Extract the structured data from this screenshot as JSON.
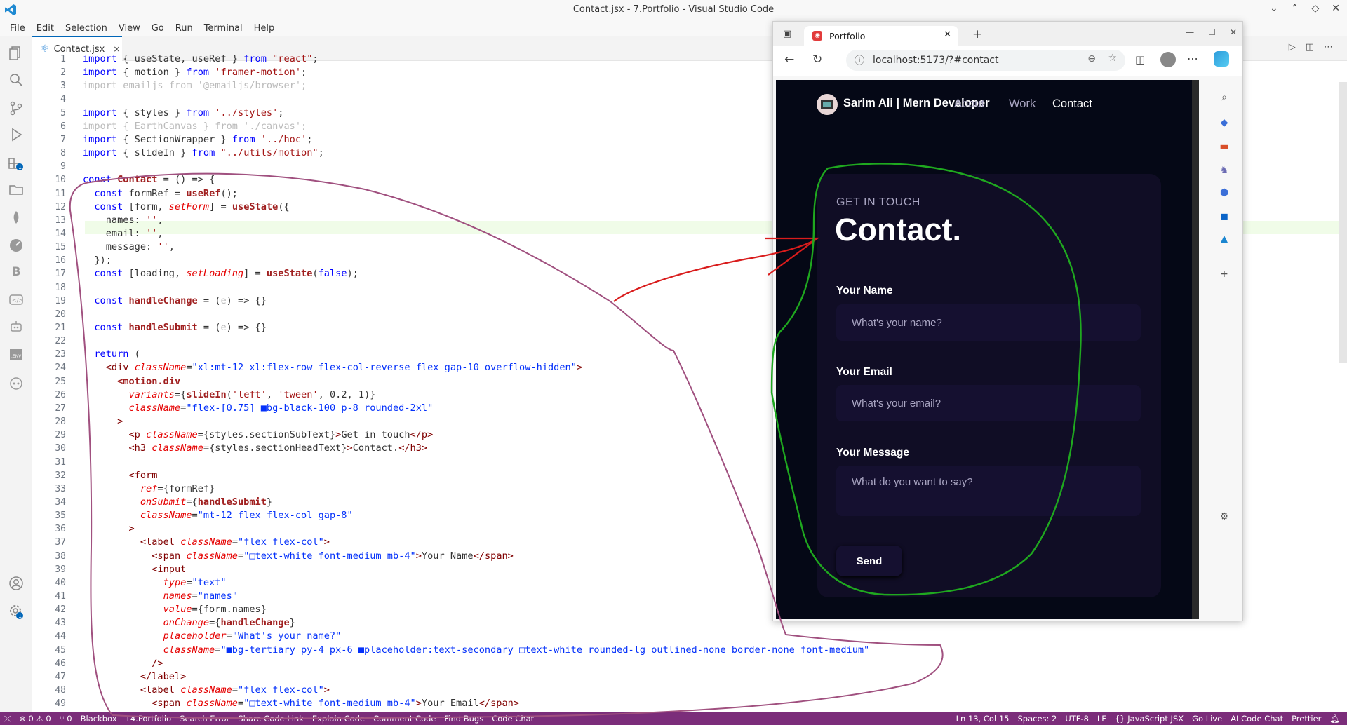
{
  "window": {
    "title": "Contact.jsx - 7.Portfolio - Visual Studio Code"
  },
  "menu": [
    "File",
    "Edit",
    "Selection",
    "View",
    "Go",
    "Run",
    "Terminal",
    "Help"
  ],
  "tab": {
    "label": "Contact.jsx",
    "close": "×"
  },
  "editor": {
    "lines": [
      {
        "n": "1",
        "html": "<span class='kw'>import</span> { useState, useRef } <span class='kw'>from</span> <span class='str'>\"react\"</span>;"
      },
      {
        "n": "2",
        "html": "<span class='kw'>import</span> { motion } <span class='kw'>from</span> <span class='str'>'framer-motion'</span>;"
      },
      {
        "n": "3",
        "html": "<span class='cm'>import emailjs from '@emailjs/browser';</span>"
      },
      {
        "n": "4",
        "html": ""
      },
      {
        "n": "5",
        "html": "<span class='kw'>import</span> { styles } <span class='kw'>from</span> <span class='str'>'../styles'</span>;"
      },
      {
        "n": "6",
        "html": "<span class='cm'>import { EarthCanvas } from './canvas';</span>"
      },
      {
        "n": "7",
        "html": "<span class='kw'>import</span> { SectionWrapper } <span class='kw'>from</span> <span class='str'>'../hoc'</span>;"
      },
      {
        "n": "8",
        "html": "<span class='kw'>import</span> { slideIn } <span class='kw'>from</span> <span class='str'>\"../utils/motion\"</span>;"
      },
      {
        "n": "9",
        "html": ""
      },
      {
        "n": "10",
        "html": "<span class='kw'>const</span> <span class='fn'>Contact</span> = () => {"
      },
      {
        "n": "11",
        "html": "  <span class='kw'>const</span> formRef = <span class='fn'>useRef</span>();"
      },
      {
        "n": "12",
        "html": "  <span class='kw'>const</span> [form, <span class='at'>setForm</span>] = <span class='fn'>useState</span>({"
      },
      {
        "n": "13",
        "html": "    names: <span class='str'>''</span>,"
      },
      {
        "n": "14",
        "html": "    email: <span class='str'>''</span>,"
      },
      {
        "n": "15",
        "html": "    message: <span class='str'>''</span>,"
      },
      {
        "n": "16",
        "html": "  });"
      },
      {
        "n": "17",
        "html": "  <span class='kw'>const</span> [loading, <span class='at'>setLoading</span>] = <span class='fn'>useState</span>(<span class='kw'>false</span>);"
      },
      {
        "n": "18",
        "html": ""
      },
      {
        "n": "19",
        "html": "  <span class='kw'>const</span> <span class='fn'>handleChange</span> = (<span class='cm'>e</span>) => {}"
      },
      {
        "n": "20",
        "html": ""
      },
      {
        "n": "21",
        "html": "  <span class='kw'>const</span> <span class='fn'>handleSubmit</span> = (<span class='cm'>e</span>) => {}"
      },
      {
        "n": "22",
        "html": ""
      },
      {
        "n": "23",
        "html": "  <span class='kw'>return</span> ("
      },
      {
        "n": "24",
        "html": "    <span class='tg'>&lt;div</span> <span class='at'>className</span>=<span class='br'>\"xl:mt-12 xl:flex-row flex-col-reverse flex gap-10 overflow-hidden\"</span><span class='tg'>&gt;</span>"
      },
      {
        "n": "25",
        "html": "      <span class='fn'>&lt;motion.div</span>"
      },
      {
        "n": "26",
        "html": "        <span class='at'>variants</span>={<span class='fn'>slideIn</span>(<span class='str'>'left'</span>, <span class='str'>'tween'</span>, 0.2, 1)}"
      },
      {
        "n": "27",
        "html": "        <span class='at'>className</span>=<span class='br'>\"flex-[0.75] ■bg-black-100 p-8 rounded-2xl\"</span>"
      },
      {
        "n": "28",
        "html": "      <span class='tg'>&gt;</span>"
      },
      {
        "n": "29",
        "html": "        <span class='tg'>&lt;p</span> <span class='at'>className</span>={styles.sectionSubText}<span class='tg'>&gt;</span>Get in touch<span class='tg'>&lt;/p&gt;</span>"
      },
      {
        "n": "30",
        "html": "        <span class='tg'>&lt;h3</span> <span class='at'>className</span>={styles.sectionHeadText}<span class='tg'>&gt;</span>Contact.<span class='tg'>&lt;/h3&gt;</span>"
      },
      {
        "n": "31",
        "html": ""
      },
      {
        "n": "32",
        "html": "        <span class='tg'>&lt;form</span>"
      },
      {
        "n": "33",
        "html": "          <span class='at'>ref</span>={formRef}"
      },
      {
        "n": "34",
        "html": "          <span class='at'>onSubmit</span>={<span class='fn'>handleSubmit</span>}"
      },
      {
        "n": "35",
        "html": "          <span class='at'>className</span>=<span class='br'>\"mt-12 flex flex-col gap-8\"</span>"
      },
      {
        "n": "36",
        "html": "        <span class='tg'>&gt;</span>"
      },
      {
        "n": "37",
        "html": "          <span class='tg'>&lt;label</span> <span class='at'>className</span>=<span class='br'>\"flex flex-col\"</span><span class='tg'>&gt;</span>"
      },
      {
        "n": "38",
        "html": "            <span class='tg'>&lt;span</span> <span class='at'>className</span>=<span class='br'>\"□text-white font-medium mb-4\"</span><span class='tg'>&gt;</span>Your Name<span class='tg'>&lt;/span&gt;</span>"
      },
      {
        "n": "39",
        "html": "            <span class='tg'>&lt;input</span>"
      },
      {
        "n": "40",
        "html": "              <span class='at'>type</span>=<span class='br'>\"text\"</span>"
      },
      {
        "n": "41",
        "html": "              <span class='at'>names</span>=<span class='br'>\"names\"</span>"
      },
      {
        "n": "42",
        "html": "              <span class='at'>value</span>={form.names}"
      },
      {
        "n": "43",
        "html": "              <span class='at'>onChange</span>={<span class='fn'>handleChange</span>}"
      },
      {
        "n": "44",
        "html": "              <span class='at'>placeholder</span>=<span class='br'>\"What's your name?\"</span>"
      },
      {
        "n": "45",
        "html": "              <span class='at'>className</span>=<span class='br'>\"■bg-tertiary py-4 px-6 ■placeholder:text-secondary □text-white rounded-lg outlined-none border-none font-medium\"</span>"
      },
      {
        "n": "46",
        "html": "            <span class='tg'>/&gt;</span>"
      },
      {
        "n": "47",
        "html": "          <span class='tg'>&lt;/label&gt;</span>"
      },
      {
        "n": "48",
        "html": "          <span class='tg'>&lt;label</span> <span class='at'>className</span>=<span class='br'>\"flex flex-col\"</span><span class='tg'>&gt;</span>"
      },
      {
        "n": "49",
        "html": "            <span class='tg'>&lt;span</span> <span class='at'>className</span>=<span class='br'>\"□text-white font-medium mb-4\"</span><span class='tg'>&gt;</span>Your Email<span class='tg'>&lt;/span&gt;</span>"
      }
    ]
  },
  "statusbar": {
    "left": [
      "⊗ 0 ⚠ 0",
      "⑂ 0",
      "Blackbox",
      "14.Portfolio",
      "Search Error",
      "Share Code Link",
      "Explain Code",
      "Comment Code",
      "Find Bugs",
      "Code Chat"
    ],
    "right": [
      "Ln 13, Col 15",
      "Spaces: 2",
      "UTF-8",
      "LF",
      "{} JavaScript JSX",
      "Go Live",
      "AI Code Chat",
      "Prettier"
    ]
  },
  "browser": {
    "tab_title": "Portfolio",
    "url": "localhost:5173/?#contact"
  },
  "site": {
    "brand": "Sarim Ali  | Mern Developer",
    "nav": [
      "About",
      "Work",
      "Contact"
    ],
    "subtitle": "GET IN TOUCH",
    "heading": "Contact.",
    "fields": [
      {
        "label": "Your Name",
        "placeholder": "What's your name?"
      },
      {
        "label": "Your Email",
        "placeholder": "What's your email?"
      },
      {
        "label": "Your Message",
        "placeholder": "What do you want to say?"
      }
    ],
    "send": "Send"
  },
  "colors": {
    "accent": "#0066b8",
    "status": "#7b2d7a",
    "site_bg": "#050816",
    "card": "#100d25",
    "input": "#151030"
  }
}
